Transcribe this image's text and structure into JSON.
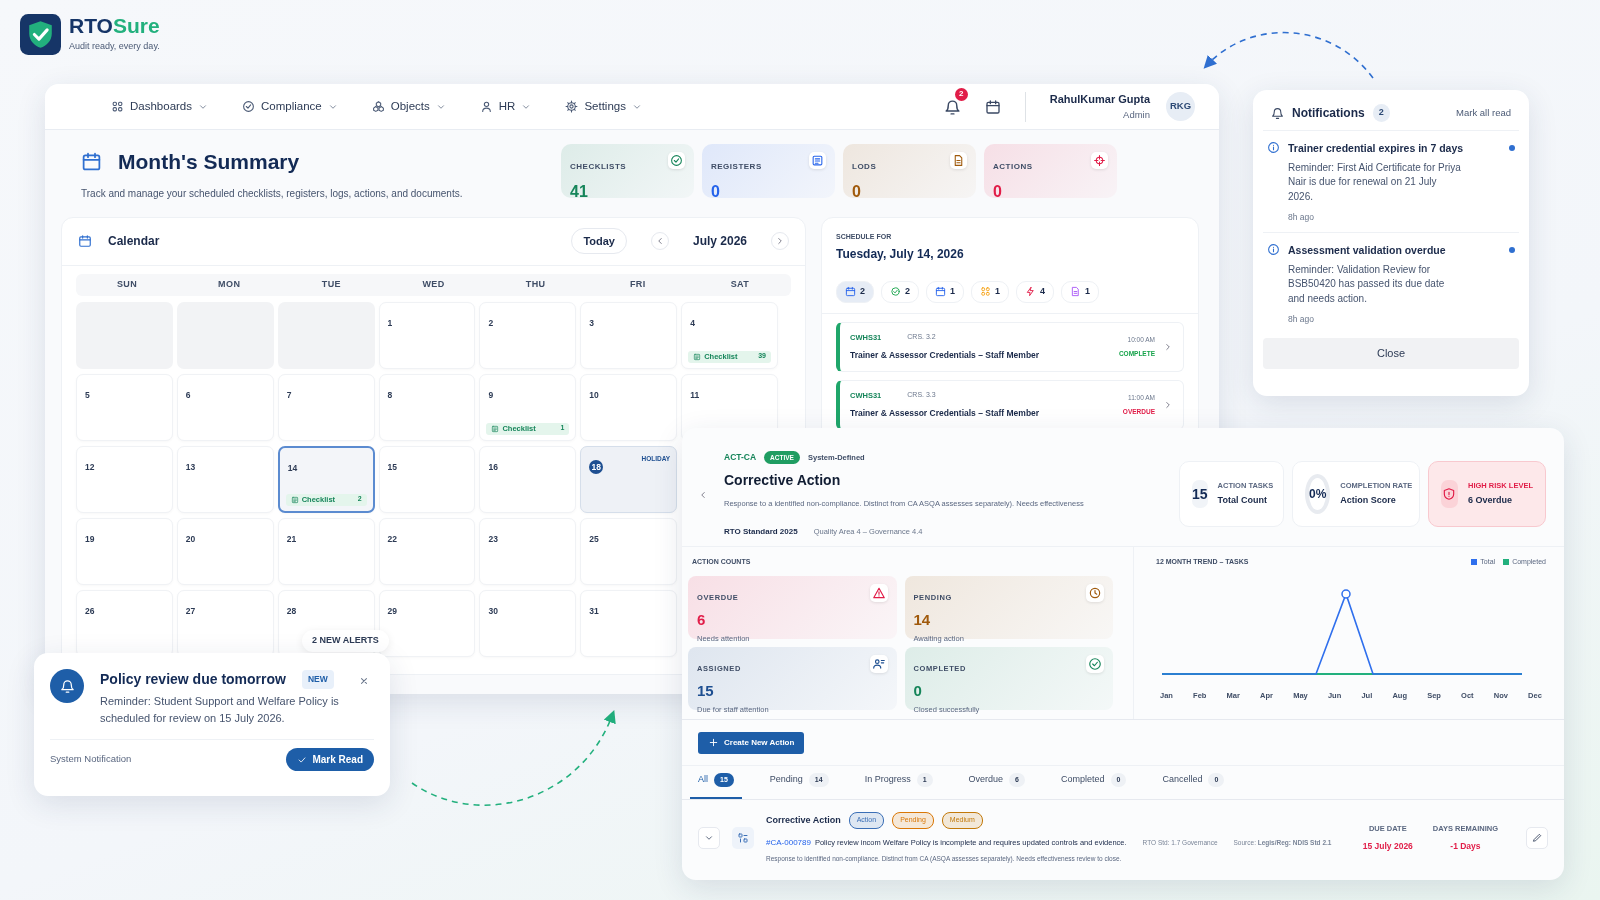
{
  "brand": {
    "name": "RTO",
    "name_accent": "Sure",
    "tagline": "Audit ready, every day."
  },
  "nav": {
    "menus": [
      "Dashboards",
      "Compliance",
      "Objects",
      "HR",
      "Settings"
    ],
    "bell_badge": "2",
    "user": {
      "name": "RahulKumar Gupta",
      "role": "Admin",
      "initials": "RKG"
    }
  },
  "summary": {
    "title": "Month's Summary",
    "subtitle": "Track and manage your scheduled checklists, registers, logs, actions, and documents."
  },
  "stats": [
    {
      "label": "CHECKLISTS",
      "value": "41",
      "color": "#16855a"
    },
    {
      "label": "REGISTERS",
      "value": "0",
      "color": "#2563eb"
    },
    {
      "label": "LODS",
      "value": "0",
      "color": "#a05a0c"
    },
    {
      "label": "ACTIONS",
      "value": "0",
      "color": "#e11d48"
    }
  ],
  "calendar": {
    "title": "Calendar",
    "today_button": "Today",
    "month": "July 2026",
    "weekdays": [
      "SUN",
      "MON",
      "TUE",
      "WED",
      "THU",
      "FRI",
      "SAT"
    ],
    "weeks": [
      [
        {
          "kind": "blank"
        },
        {
          "kind": "blank"
        },
        {
          "kind": "blank"
        },
        {
          "kind": "day",
          "day": "1",
          "selected": false,
          "today": false
        },
        {
          "kind": "day",
          "day": "2",
          "selected": false,
          "today": false
        },
        {
          "kind": "day",
          "day": "3",
          "selected": false,
          "today": false
        },
        {
          "kind": "day",
          "day": "4",
          "selected": false,
          "today": false,
          "events": [
            {
              "label": "Checklist",
              "count": "39"
            }
          ]
        }
      ],
      [
        {
          "kind": "day",
          "day": "5",
          "selected": false,
          "today": false
        },
        {
          "kind": "day",
          "day": "6",
          "selected": false,
          "today": false
        },
        {
          "kind": "day",
          "day": "7",
          "selected": false,
          "today": false
        },
        {
          "kind": "day",
          "day": "8",
          "selected": false,
          "today": false
        },
        {
          "kind": "day",
          "day": "9",
          "selected": false,
          "today": false,
          "events": [
            {
              "label": "Checklist",
              "count": "1"
            }
          ]
        },
        {
          "kind": "day",
          "day": "10",
          "selected": false,
          "today": false
        },
        {
          "kind": "day",
          "day": "11",
          "selected": false,
          "today": false
        }
      ],
      [
        {
          "kind": "day",
          "day": "12",
          "selected": false,
          "today": false
        },
        {
          "kind": "day",
          "day": "13",
          "selected": false,
          "today": false
        },
        {
          "kind": "day",
          "day": "14",
          "selected": true,
          "today": false,
          "events": [
            {
              "label": "Checklist",
              "count": "2"
            }
          ]
        },
        {
          "kind": "day",
          "day": "15",
          "selected": false,
          "today": false
        },
        {
          "kind": "day",
          "day": "16",
          "selected": false,
          "today": false
        },
        {
          "kind": "day",
          "day": "18",
          "selected": false,
          "today": true,
          "tag": "HOLIDAY"
        }
      ],
      [
        {
          "kind": "day",
          "day": "19",
          "selected": false,
          "today": false
        },
        {
          "kind": "day",
          "day": "20",
          "selected": false,
          "today": false
        },
        {
          "kind": "day",
          "day": "21",
          "selected": false,
          "today": false
        },
        {
          "kind": "day",
          "day": "22",
          "selected": false,
          "today": false
        },
        {
          "kind": "day",
          "day": "23",
          "selected": false,
          "today": false
        },
        {
          "kind": "day",
          "day": "25",
          "selected": false,
          "today": false
        }
      ],
      [
        {
          "kind": "day",
          "day": "26",
          "selected": false,
          "today": false
        },
        {
          "kind": "day",
          "day": "27",
          "selected": false,
          "today": false
        },
        {
          "kind": "day",
          "day": "28",
          "selected": false,
          "today": false
        },
        {
          "kind": "day",
          "day": "29",
          "selected": false,
          "today": false
        },
        {
          "kind": "day",
          "day": "30",
          "selected": false,
          "today": false
        },
        {
          "kind": "day",
          "day": "31",
          "selected": false,
          "today": false
        }
      ]
    ]
  },
  "alerts_pill": "2 NEW ALERTS",
  "schedule": {
    "heading": "SCHEDULE FOR",
    "date": "Tuesday, July 14, 2026",
    "filters": [
      {
        "count": "2",
        "selected": true
      },
      {
        "count": "2",
        "selected": false
      },
      {
        "count": "1",
        "selected": false
      },
      {
        "count": "1",
        "selected": false
      },
      {
        "count": "4",
        "selected": false
      },
      {
        "count": "1",
        "selected": false
      }
    ],
    "items": [
      {
        "code": "CWHS31",
        "ref": "CRS. 3.2",
        "time": "10:00 AM",
        "status": "COMPLETE",
        "color": "#16a34a",
        "title": "Trainer & Assessor Credentials – Staff Member"
      },
      {
        "code": "CWHS31",
        "ref": "CRS. 3.3",
        "time": "11:00 AM",
        "status": "OVERDUE",
        "color": "#e11d48",
        "title": "Trainer & Assessor Credentials – Staff Member"
      }
    ]
  },
  "notifications": {
    "title": "Notifications",
    "count": "2",
    "mark_all": "Mark all read",
    "close": "Close",
    "items": [
      {
        "title": "Trainer credential expires in 7 days",
        "body": "Reminder: First Aid Certificate for Priya Nair is due for renewal on 21 July 2026.",
        "time": "8h ago",
        "unread": true
      },
      {
        "title": "Assessment validation overdue",
        "body": "Reminder: Validation Review for BSB50420 has passed its due date and needs action.",
        "time": "8h ago",
        "unread": true
      }
    ]
  },
  "corrective_action": {
    "code": "ACT-CA",
    "status": "ACTIVE",
    "origin": "System-Defined",
    "title": "Corrective Action",
    "description": "Response to a identified non-compliance. Distinct from CA ASQA assesses separately). Needs effectiveness",
    "standard": "RTO Standard 2025",
    "area": "Quality Area 4 – Governance 4.4",
    "metrics": [
      {
        "kind": "count",
        "value": "15",
        "label": "ACTION TASKS",
        "sub": "Total Count"
      },
      {
        "kind": "rate",
        "value": "0%",
        "label": "COMPLETION RATE",
        "sub": "Action Score"
      },
      {
        "kind": "risk",
        "label": "HIGH RISK LEVEL",
        "sub": "6 Overdue"
      }
    ],
    "counts_title": "ACTION COUNTS",
    "counts": [
      {
        "label": "OVERDUE",
        "value": "6",
        "note": "Needs attention",
        "color": "#e11d48"
      },
      {
        "label": "PENDING",
        "value": "14",
        "note": "Awaiting action",
        "color": "#a05a0c"
      },
      {
        "label": "ASSIGNED",
        "value": "15",
        "note": "Due for staff attention",
        "color": "#1e4f91"
      },
      {
        "label": "COMPLETED",
        "value": "0",
        "note": "Closed successfully",
        "color": "#16855a"
      }
    ],
    "trend": {
      "title": "12 MONTH TREND – TASKS",
      "legend": [
        {
          "name": "Total",
          "color": "#2f6fed"
        },
        {
          "name": "Completed",
          "color": "#22b07d"
        }
      ],
      "months": [
        "Jan",
        "Feb",
        "Mar",
        "Apr",
        "May",
        "Jun",
        "Jul",
        "Aug",
        "Sep",
        "Oct",
        "Nov",
        "Dec"
      ]
    },
    "create_button": "Create New Action",
    "tabs": [
      {
        "label": "All",
        "count": "15",
        "selected": true
      },
      {
        "label": "Pending",
        "count": "14",
        "selected": false
      },
      {
        "label": "In Progress",
        "count": "1",
        "selected": false
      },
      {
        "label": "Overdue",
        "count": "6",
        "selected": false
      },
      {
        "label": "Completed",
        "count": "0",
        "selected": false
      },
      {
        "label": "Cancelled",
        "count": "0",
        "selected": false
      }
    ],
    "row": {
      "title": "Corrective Action",
      "tags": [
        {
          "label": "Action",
          "color": "#3b6fb6"
        },
        {
          "label": "Pending",
          "color": "#d97706"
        },
        {
          "label": "Medium",
          "color": "#c2790a"
        }
      ],
      "ref": "#CA-000789",
      "text": "Policy review incom Welfare Policy is incomplete and requires updated controls and evidence.",
      "std": "RTO Std: 1.7 Governance",
      "source": "Source: **Legis/Reg: NDIS Std 2.1**",
      "note": "Response to identified non-compliance. Distinct from CA (ASQA assesses separately). Needs effectiveness review to close.",
      "due_label": "DUE DATE",
      "due": "15 July 2026",
      "days_label": "DAYS REMAINING",
      "days": "-1 Days"
    }
  },
  "toast": {
    "title": "Policy review due tomorrow",
    "badge": "NEW",
    "body": "Reminder: Student Support and Welfare Policy is scheduled for review on 15 July 2026.",
    "footer": "System Notification",
    "button": "Mark Read"
  }
}
